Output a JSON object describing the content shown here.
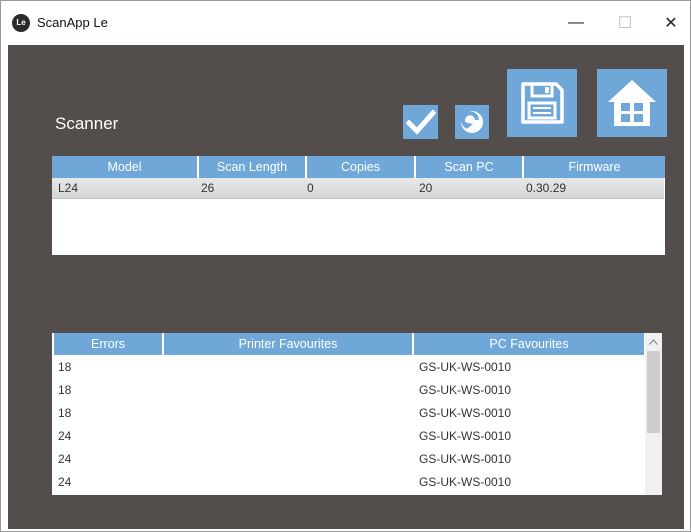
{
  "window": {
    "logo_text": "Le",
    "title": "ScanApp Le",
    "minimize_glyph": "—",
    "maximize_glyph": "☐",
    "close_glyph": "✕"
  },
  "scanner": {
    "title": "Scanner",
    "toolbar": {
      "confirm_icon": "check-icon",
      "refresh_icon": "refresh-icon",
      "save_icon": "save-icon",
      "home_icon": "home-icon"
    },
    "columns": [
      "Model",
      "Scan Length",
      "Copies",
      "Scan PC",
      "Firmware"
    ],
    "rows": [
      [
        "L24",
        "26",
        "0",
        "20",
        "0.30.29"
      ]
    ]
  },
  "favourites": {
    "columns": [
      "Errors",
      "Printer Favourites",
      "PC Favourites"
    ],
    "rows": [
      [
        "18",
        "",
        "GS-UK-WS-0010"
      ],
      [
        "18",
        "",
        "GS-UK-WS-0010"
      ],
      [
        "18",
        "",
        "GS-UK-WS-0010"
      ],
      [
        "24",
        "",
        "GS-UK-WS-0010"
      ],
      [
        "24",
        "",
        "GS-UK-WS-0010"
      ],
      [
        "24",
        "",
        "GS-UK-WS-0010"
      ]
    ]
  },
  "colors": {
    "accent": "#6fa8d8",
    "background": "#534e4c"
  }
}
